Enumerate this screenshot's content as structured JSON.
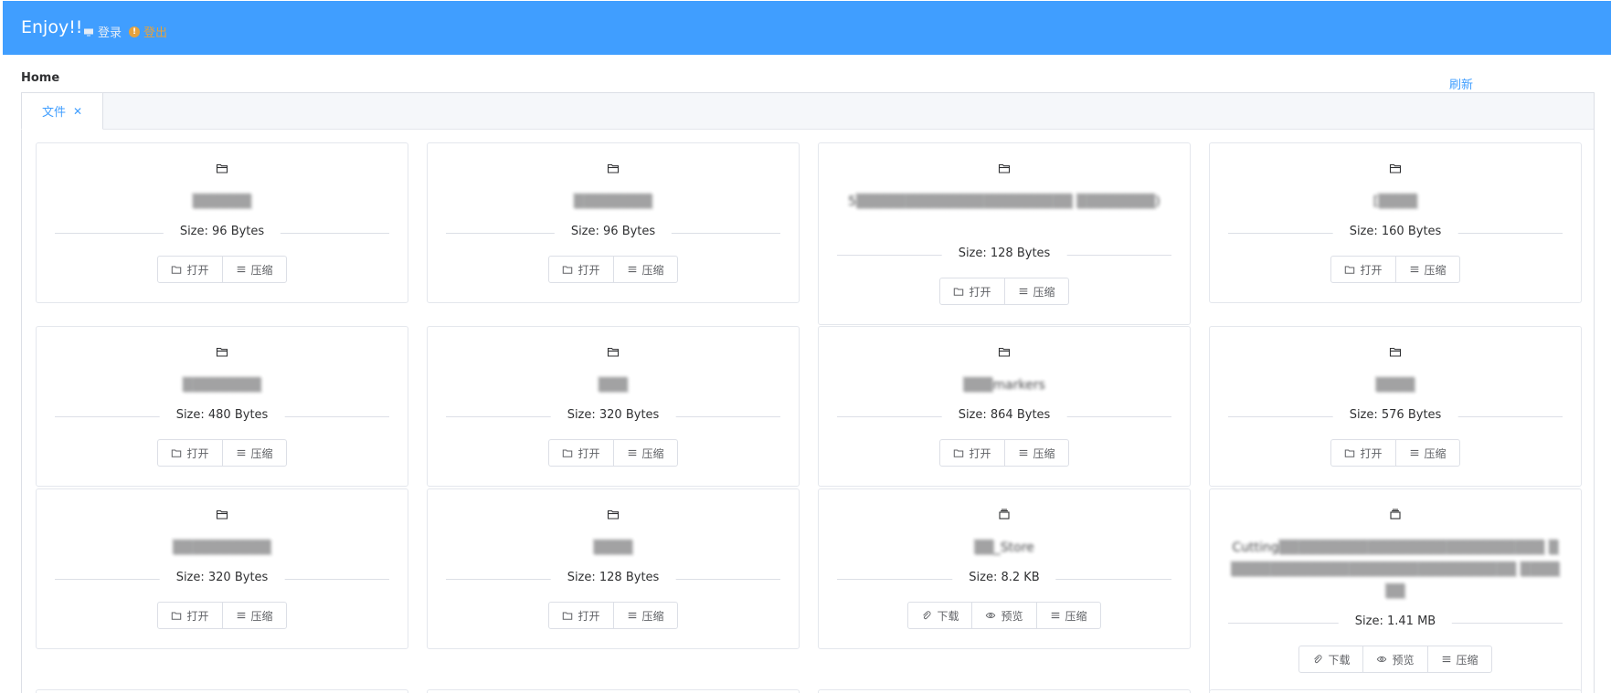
{
  "header": {
    "brand": "Enjoy!!",
    "login_label": "登录",
    "logout_label": "登出"
  },
  "breadcrumb": {
    "home": "Home"
  },
  "refresh_label": "刷新",
  "tabs": [
    {
      "label": "文件"
    }
  ],
  "buttons": {
    "open": "打开",
    "zip": "压缩",
    "download": "下载",
    "preview": "预览"
  },
  "files": [
    {
      "type": "folder",
      "name": "▒▒▒▒▒▒",
      "size": "Size: 96 Bytes"
    },
    {
      "type": "folder",
      "name": "▒▒▒▒▒▒▒▒",
      "size": "Size: 96 Bytes"
    },
    {
      "type": "folder",
      "name": "5▒▒▒▒▒▒▒▒▒▒▒▒▒▒▒▒▒▒▒▒▒▒ ▒▒▒▒▒▒▒▒)",
      "size": "Size: 128 Bytes"
    },
    {
      "type": "folder",
      "name": "[▒▒▒▒",
      "size": "Size: 160 Bytes"
    },
    {
      "type": "folder",
      "name": "▒▒▒▒▒▒▒▒",
      "size": "Size: 480 Bytes"
    },
    {
      "type": "folder",
      "name": "▒▒▒",
      "size": "Size: 320 Bytes"
    },
    {
      "type": "folder",
      "name": "▒▒▒markers",
      "size": "Size: 864 Bytes"
    },
    {
      "type": "folder",
      "name": "▒▒▒▒",
      "size": "Size: 576 Bytes"
    },
    {
      "type": "folder",
      "name": "▒▒▒▒▒▒▒▒▒▒",
      "size": "Size: 320 Bytes"
    },
    {
      "type": "folder",
      "name": "▒▒▒▒",
      "size": "Size: 128 Bytes"
    },
    {
      "type": "file",
      "name": "▒▒_Store",
      "size": "Size: 8.2 KB"
    },
    {
      "type": "file",
      "name": "Cutting▒▒▒▒▒▒▒▒▒▒▒▒▒▒▒▒▒▒▒▒▒▒▒▒▒▒▒ ▒▒▒▒▒▒▒▒▒▒▒▒▒▒▒▒▒▒▒▒▒▒▒▒▒▒▒▒▒▒ ▒▒▒▒▒▒",
      "size": "Size: 1.41 MB"
    }
  ]
}
